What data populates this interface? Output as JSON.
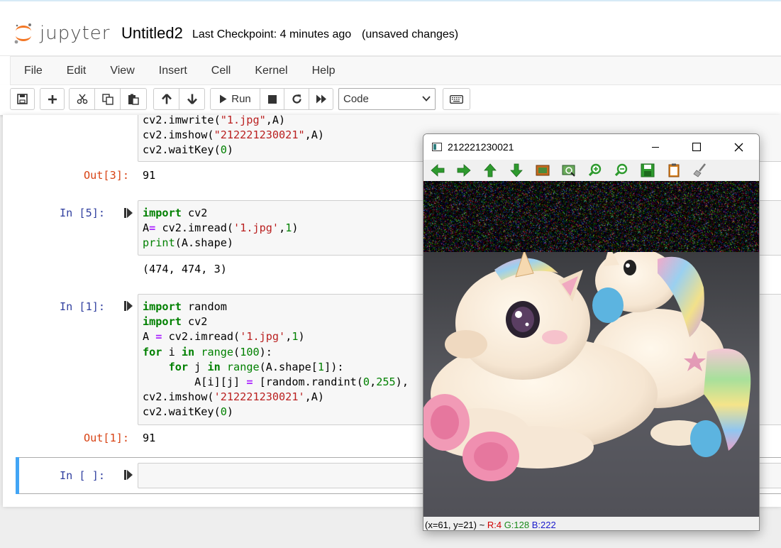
{
  "app": {
    "logo_text": "jupyter",
    "notebook_title": "Untitled2",
    "checkpoint": "Last Checkpoint: 4 minutes ago",
    "unsaved": "(unsaved changes)"
  },
  "menu": [
    "File",
    "Edit",
    "View",
    "Insert",
    "Cell",
    "Kernel",
    "Help"
  ],
  "toolbar": {
    "run_label": "Run",
    "cell_type": "Code",
    "buttons": [
      "save-icon",
      "plus-icon",
      "scissors-icon",
      "copy-icon",
      "paste-icon",
      "arrow-up-icon",
      "arrow-down-icon",
      "run-icon",
      "stop-icon",
      "restart-icon",
      "fast-forward-icon",
      "keyboard-icon"
    ]
  },
  "cells": {
    "cell_3_tail": {
      "lines": [
        "cv2.imwrite(\"1.jpg\",A)",
        "cv2.imshow(\"212221230021\",A)",
        "cv2.waitKey(0)"
      ],
      "out_prompt": "Out[3]:",
      "output": "91"
    },
    "cell_5": {
      "in_prompt": "In [5]:",
      "lines": [
        "import cv2",
        "A= cv2.imread('1.jpg',1)",
        "print(A.shape)"
      ],
      "output": "(474, 474, 3)"
    },
    "cell_1": {
      "in_prompt": "In [1]:",
      "lines": [
        "import random",
        "import cv2",
        "A = cv2.imread('1.jpg',1)",
        "for i in range(100):",
        "    for j in range(A.shape[1]):",
        "        A[i][j] = [random.randint(0,255),",
        "cv2.imshow('212221230021',A)",
        "cv2.waitKey(0)"
      ],
      "out_prompt": "Out[1]:",
      "output": "91"
    },
    "cell_empty": {
      "in_prompt": "In [ ]:"
    }
  },
  "image_window": {
    "title": "212221230021",
    "tools": [
      "arrow-left-icon",
      "arrow-right-icon",
      "arrow-up-icon",
      "arrow-down-icon",
      "image-icon",
      "zoom-region-icon",
      "zoom-in-icon",
      "zoom-out-icon",
      "save-icon",
      "copy-icon",
      "properties-icon"
    ],
    "status_coord": "(x=61, y=21) ~",
    "status_r": "R:4",
    "status_g": "G:128",
    "status_b": "B:222",
    "noise_fraction": 0.21
  },
  "colors": {
    "keyword": "#008000",
    "string": "#ba2121",
    "in_prompt": "#303f9f",
    "out_prompt": "#d84315",
    "selected_cell": "#42a5f5"
  }
}
